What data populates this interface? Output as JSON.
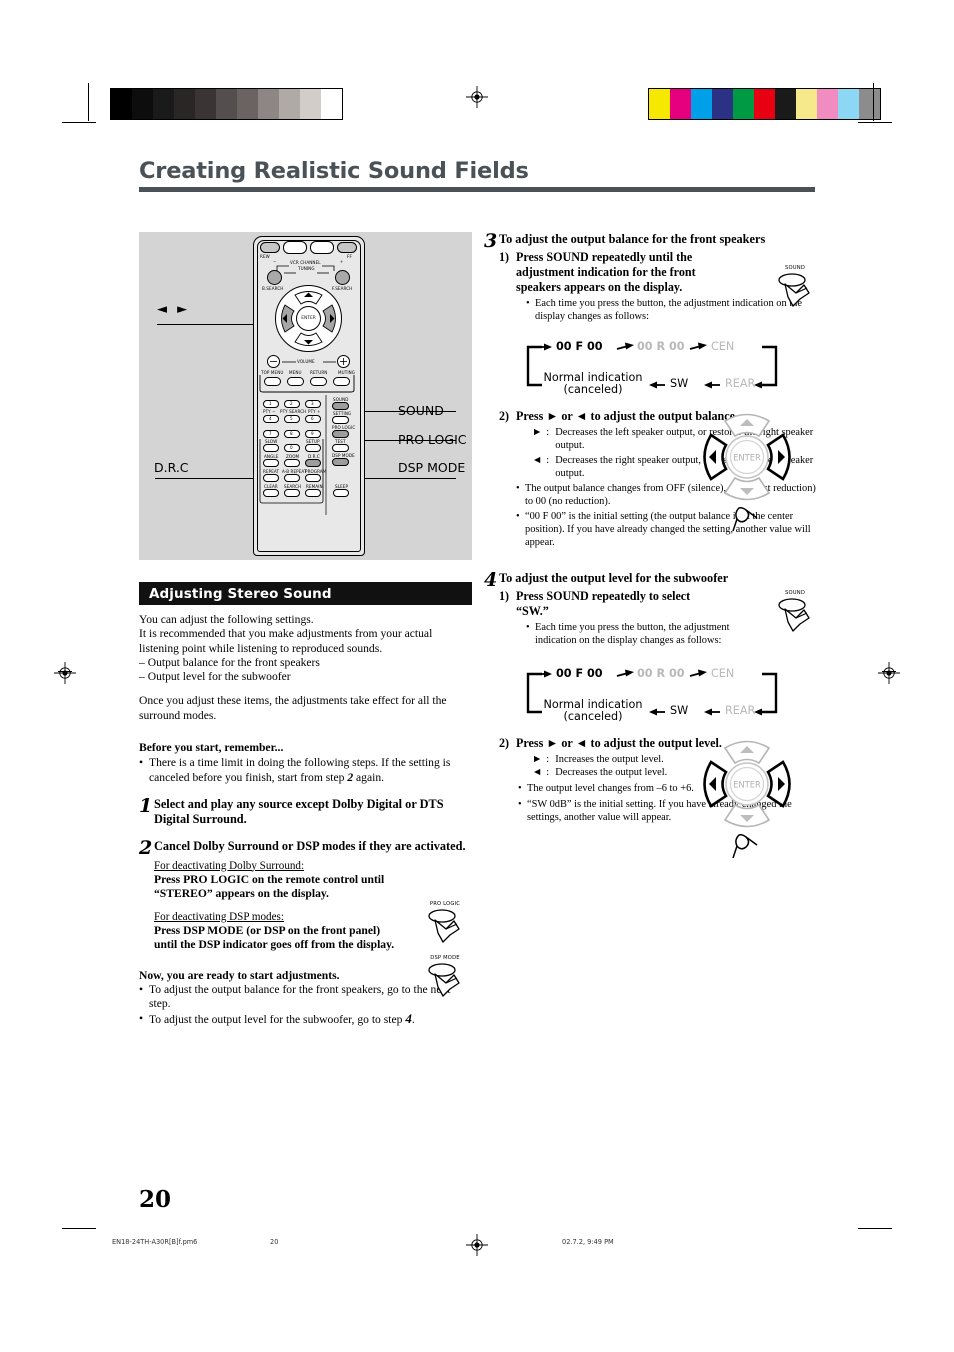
{
  "document": {
    "title": "Creating Realistic Sound Fields",
    "page_number": "20",
    "footer": {
      "filename": "EN18-24TH-A30R[B]f.pm6",
      "page": "20",
      "timestamp": "02.7.2, 9:49 PM"
    },
    "accent_color": "#4a5258"
  },
  "calibration": {
    "gray_bar": [
      "#000000",
      "#0d0d0d",
      "#1a1a1a",
      "#2a2626",
      "#3a3434",
      "#554e4e",
      "#6b6362",
      "#8d8684",
      "#b0aaa6",
      "#d2cdc8",
      "#ffffff"
    ],
    "color_bar": [
      "#f7e800",
      "#e6007e",
      "#00a0e9",
      "#2b3285",
      "#009944",
      "#e60012",
      "#1a1a1a",
      "#f6e98c",
      "#f08cc0",
      "#8cd8f4",
      "#8c8c8c"
    ]
  },
  "figure": {
    "caption_labels": {
      "cursor_arrows": "◄ ►",
      "drc": "D.R.C",
      "sound": "SOUND",
      "pro_logic": "PRO LOGIC",
      "dsp_mode": "DSP MODE"
    },
    "remote": {
      "transport": [
        "REW",
        "FF"
      ],
      "tuning_group": [
        "VCR CHANNEL",
        "TUNING",
        "−",
        "+"
      ],
      "search": [
        "B.SEARCH",
        "F.SEARCH"
      ],
      "enter": "ENTER",
      "volume": {
        "label": "VOLUME",
        "minus": "−",
        "plus": "+"
      },
      "menu_row": [
        "TOP MENU",
        "MENU",
        "RETURN",
        "MUTING"
      ],
      "numpad": [
        "1",
        "2",
        "3",
        "4",
        "5",
        "6",
        "7",
        "8",
        "9",
        "0"
      ],
      "numpad_sublabels": [
        "PTY −",
        "PTY SEARCH",
        "PTY +"
      ],
      "side_column": [
        "SOUND",
        "SETTING",
        "PRO LOGIC",
        "TEST",
        "DSP MODE"
      ],
      "function_labels": [
        "SLOW",
        "SETUP",
        "ANGLE",
        "ZOOM",
        "D.R.C",
        "REPEAT",
        "A-B REPEAT",
        "PROGRAM",
        "CLEAR",
        "SEARCH",
        "REMAIN",
        "SLEEP"
      ]
    }
  },
  "left_column": {
    "section_title": "Adjusting Stereo Sound",
    "intro": [
      "You can adjust the following settings.",
      "It is recommended that you make adjustments from your actual listening point while listening to reproduced sounds.",
      "– Output balance for the front speakers",
      "– Output level for the subwoofer"
    ],
    "intro2": "Once you adjust these items, the adjustments take effect for all the surround modes.",
    "before_heading": "Before you start, remember...",
    "before_bullet_a": "There is a time limit in doing the following steps. If the setting is canceled before you finish, start from step ",
    "before_bullet_step": "2",
    "before_bullet_b": " again.",
    "steps": [
      {
        "num": "1",
        "head": "Select and play any source except Dolby Digital or DTS Digital Surround."
      },
      {
        "num": "2",
        "head": "Cancel Dolby Surround or DSP modes if they are activated.",
        "sub1_title": "For deactivating Dolby Surround:",
        "sub1_body": "Press PRO LOGIC on the remote control until “STEREO” appears on the display.",
        "sub2_title": "For deactivating DSP modes:",
        "sub2_body": "Press DSP MODE (or DSP on the front panel) until the DSP indicator goes off from the display.",
        "icon1_label": "PRO LOGIC",
        "icon2_label": "DSP MODE"
      }
    ],
    "ready_heading": "Now, you are ready to start adjustments.",
    "ready_bullets": [
      "To adjust the output balance for the front speakers, go to the next step.",
      "To adjust the output level for the subwoofer, go to step "
    ],
    "ready_bullet2_step": "4",
    "ready_bullet2_end": "."
  },
  "right_column": {
    "step3": {
      "num": "3",
      "head": "To adjust the output balance for the front speakers",
      "sub1": {
        "num": "1)",
        "head": "Press SOUND repeatedly until the adjustment indication for the front speakers appears on the display.",
        "note": "Each time you press the button, the adjustment indication on the display changes as follows:",
        "icon_label": "SOUND"
      },
      "sub2": {
        "num": "2)",
        "head": "Press ► or ◄ to adjust the output balance.",
        "def_right_sym": "►",
        "def_right": "Decreases the left speaker output, or restores the right speaker output.",
        "def_left_sym": "◄",
        "def_left": "Decreases the right speaker output, or restores the left speaker output.",
        "notes": [
          "The output balance changes from OFF (silence), –06 (most reduction) to 00 (no reduction).",
          "“00 F 00” is the initial setting (the output balance is at the center position). If you have already changed the setting, another value will appear."
        ]
      }
    },
    "step4": {
      "num": "4",
      "head": "To adjust the output level for the subwoofer",
      "sub1": {
        "num": "1)",
        "head": "Press SOUND repeatedly to select “SW.”",
        "note": "Each time you press the button, the adjustment indication on the display changes as follows:",
        "icon_label": "SOUND"
      },
      "sub2": {
        "num": "2)",
        "head": "Press ► or ◄ to adjust the output level.",
        "def_right_sym": "►",
        "def_right": "Increases the output level.",
        "def_left_sym": "◄",
        "def_left": "Decreases the output level.",
        "notes": [
          "The output level changes from –6 to +6.",
          "“SW 0dB” is the initial setting. If you have already changed the settings, another value will appear."
        ]
      }
    },
    "flow_diagram": {
      "top_row": [
        "00 F 00",
        "00 R 00",
        "CEN"
      ],
      "bottom_row_left_line1": "Normal indication",
      "bottom_row_left_line2": "(canceled)",
      "bottom_row": [
        "SW",
        "REAR"
      ],
      "dim_items": [
        "00 R 00",
        "CEN",
        "REAR"
      ],
      "active_color": "#000000",
      "dim_color": "#b9b9b9"
    },
    "cursor_pad": {
      "enter_label": "ENTER"
    }
  }
}
